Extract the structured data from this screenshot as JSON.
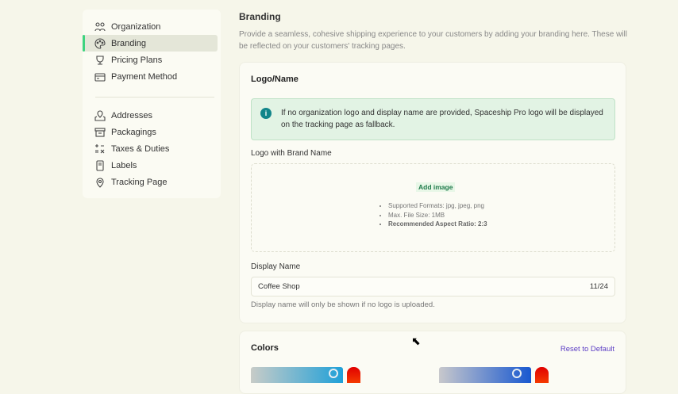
{
  "sidebar": {
    "group1": [
      {
        "label": "Organization",
        "icon": "users-icon"
      },
      {
        "label": "Branding",
        "icon": "palette-icon",
        "active": true
      },
      {
        "label": "Pricing Plans",
        "icon": "trophy-icon"
      },
      {
        "label": "Payment Method",
        "icon": "credit-card-icon"
      }
    ],
    "group2": [
      {
        "label": "Addresses",
        "icon": "map-pin-icon"
      },
      {
        "label": "Packagings",
        "icon": "archive-box-icon"
      },
      {
        "label": "Taxes & Duties",
        "icon": "calculator-icon"
      },
      {
        "label": "Labels",
        "icon": "label-icon"
      },
      {
        "label": "Tracking Page",
        "icon": "location-icon"
      }
    ]
  },
  "main": {
    "title": "Branding",
    "description": "Provide a seamless, cohesive shipping experience to your customers by adding your branding here. These will be reflected on your customers' tracking pages.",
    "logo_card": {
      "title": "Logo/Name",
      "alert": "If no organization logo and display name are provided, Spaceship Pro logo will be displayed on the tracking page as fallback.",
      "logo_label": "Logo with Brand Name",
      "add_image": "Add image",
      "requirements": [
        "Supported Formats: jpg, jpeg, png",
        "Max. File Size: 1MB",
        "Recommended Aspect Ratio: 2:3"
      ],
      "display_name_label": "Display Name",
      "display_name_value": "Coffee Shop",
      "char_count": "11/24",
      "display_name_hint": "Display name will only be shown if no logo is uploaded."
    },
    "colors_card": {
      "title": "Colors",
      "reset": "Reset to Default",
      "accent": "#5b3cc4"
    }
  }
}
